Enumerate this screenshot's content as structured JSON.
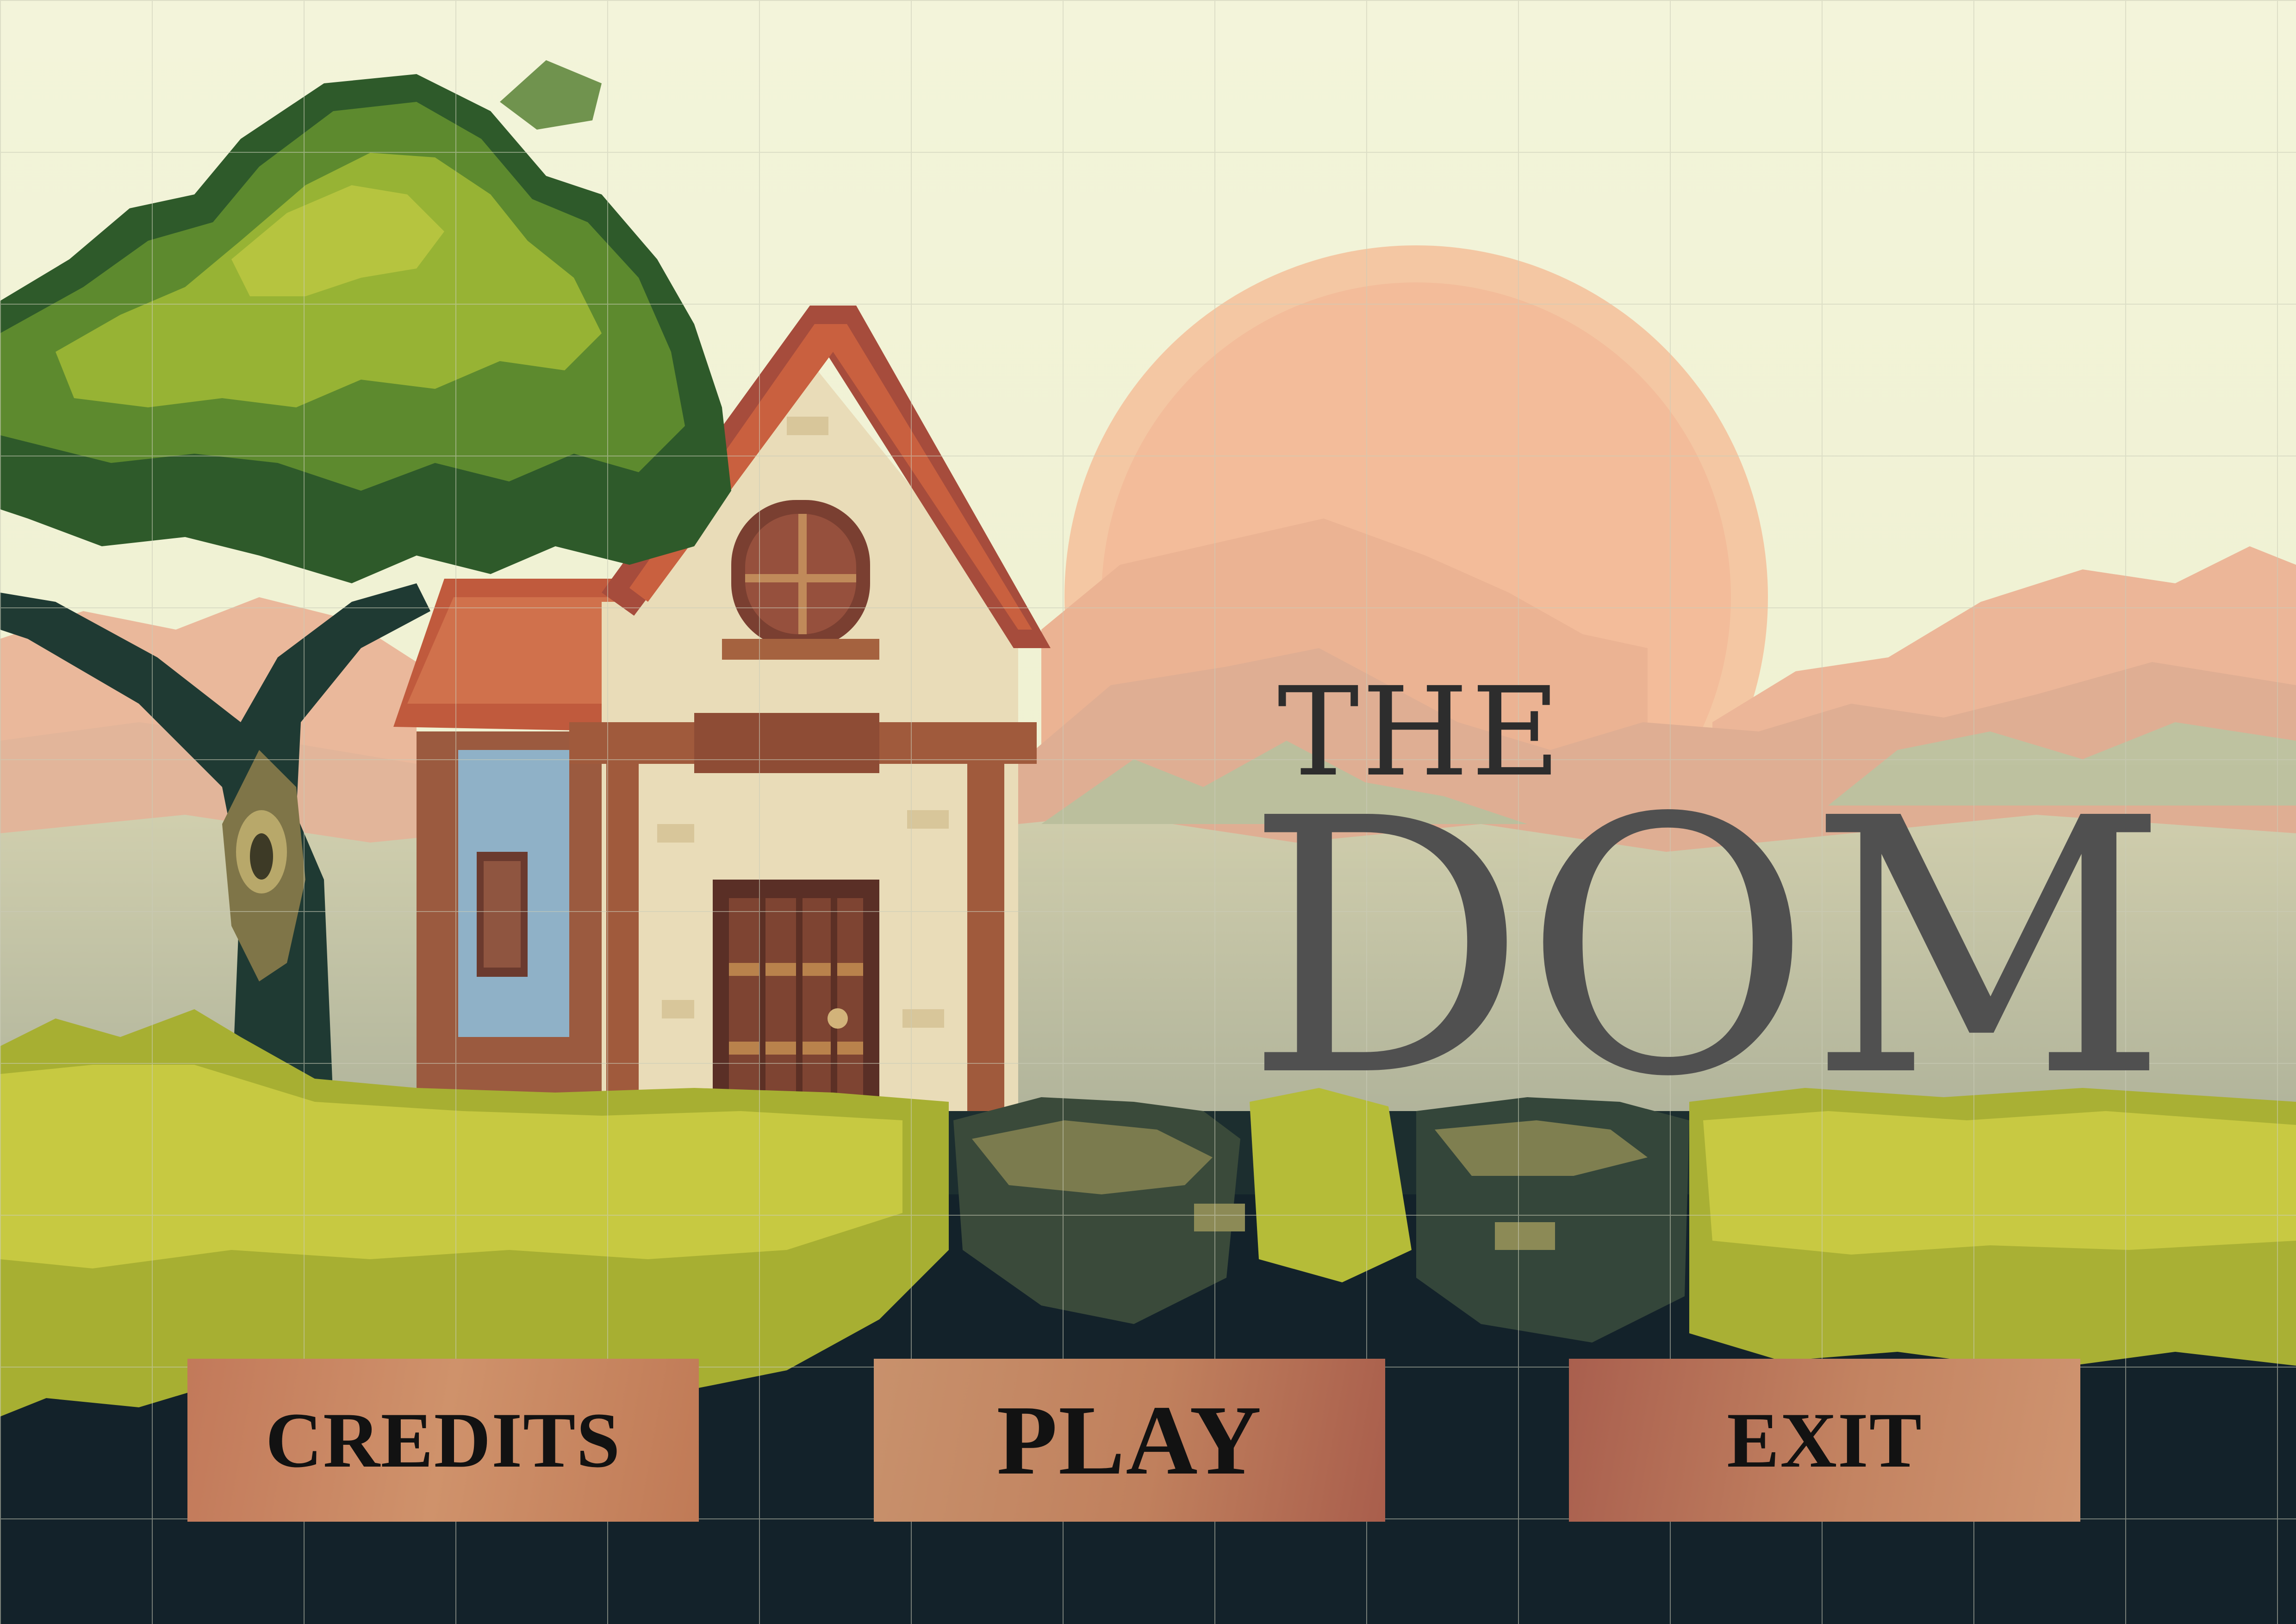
{
  "title": {
    "prefix": "THE",
    "main": "DOM"
  },
  "menu": {
    "credits_label": "CREDITS",
    "play_label": "PLAY",
    "exit_label": "EXIT"
  },
  "colors": {
    "sky": "#f1f2d6",
    "sun": "#f2b793",
    "button": "#c4825f",
    "ground": "#13222a",
    "grass": "#b9c13b",
    "title": "#4f4f4f"
  }
}
